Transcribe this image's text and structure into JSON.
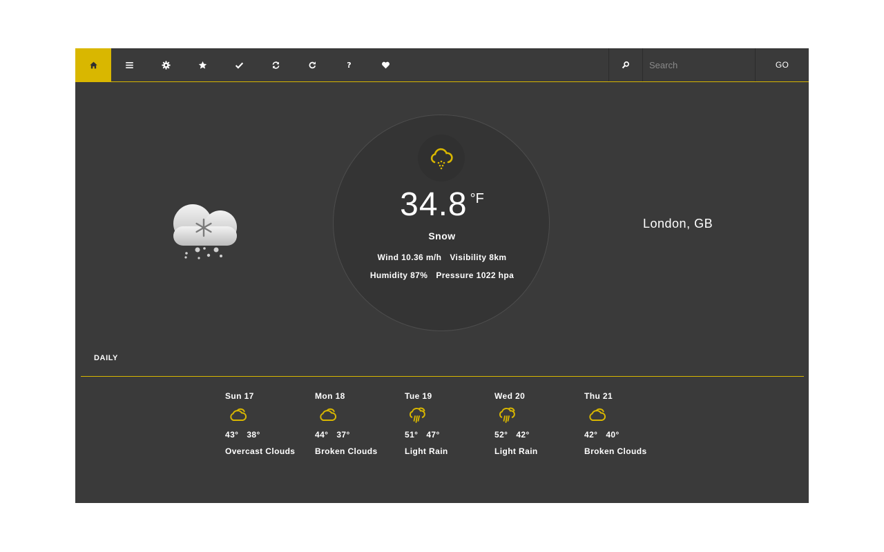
{
  "nav": {
    "items": [
      {
        "name": "home",
        "icon": "home-icon"
      },
      {
        "name": "menu",
        "icon": "menu-icon"
      },
      {
        "name": "settings",
        "icon": "gear-icon"
      },
      {
        "name": "favorites",
        "icon": "star-icon"
      },
      {
        "name": "check",
        "icon": "check-icon"
      },
      {
        "name": "sync",
        "icon": "sync-icon"
      },
      {
        "name": "refresh",
        "icon": "refresh-icon"
      },
      {
        "name": "help",
        "icon": "question-icon",
        "glyph": "?"
      },
      {
        "name": "love",
        "icon": "heart-icon"
      }
    ],
    "search_placeholder": "Search",
    "search_value": "",
    "go_label": "GO"
  },
  "current": {
    "temperature": "34.8",
    "unit": "°F",
    "condition": "Snow",
    "wind": "Wind 10.36 m/h",
    "visibility": "Visibility 8km",
    "humidity": "Humidity 87%",
    "pressure": "Pressure 1022 hpa",
    "location": "London, GB"
  },
  "daily": {
    "title": "DAILY",
    "days": [
      {
        "name": "Sun 17",
        "high": "43°",
        "low": "38°",
        "desc": "Overcast Clouds",
        "icon": "cloud-icon"
      },
      {
        "name": "Mon 18",
        "high": "44°",
        "low": "37°",
        "desc": "Broken Clouds",
        "icon": "cloud-icon"
      },
      {
        "name": "Tue 19",
        "high": "51°",
        "low": "47°",
        "desc": "Light Rain",
        "icon": "rain-icon"
      },
      {
        "name": "Wed 20",
        "high": "52°",
        "low": "42°",
        "desc": "Light Rain",
        "icon": "rain-icon"
      },
      {
        "name": "Thu 21",
        "high": "42°",
        "low": "40°",
        "desc": "Broken Clouds",
        "icon": "cloud-icon"
      }
    ]
  },
  "colors": {
    "accent": "#d9b700",
    "background": "#3a3a3a",
    "circle": "#343434"
  }
}
